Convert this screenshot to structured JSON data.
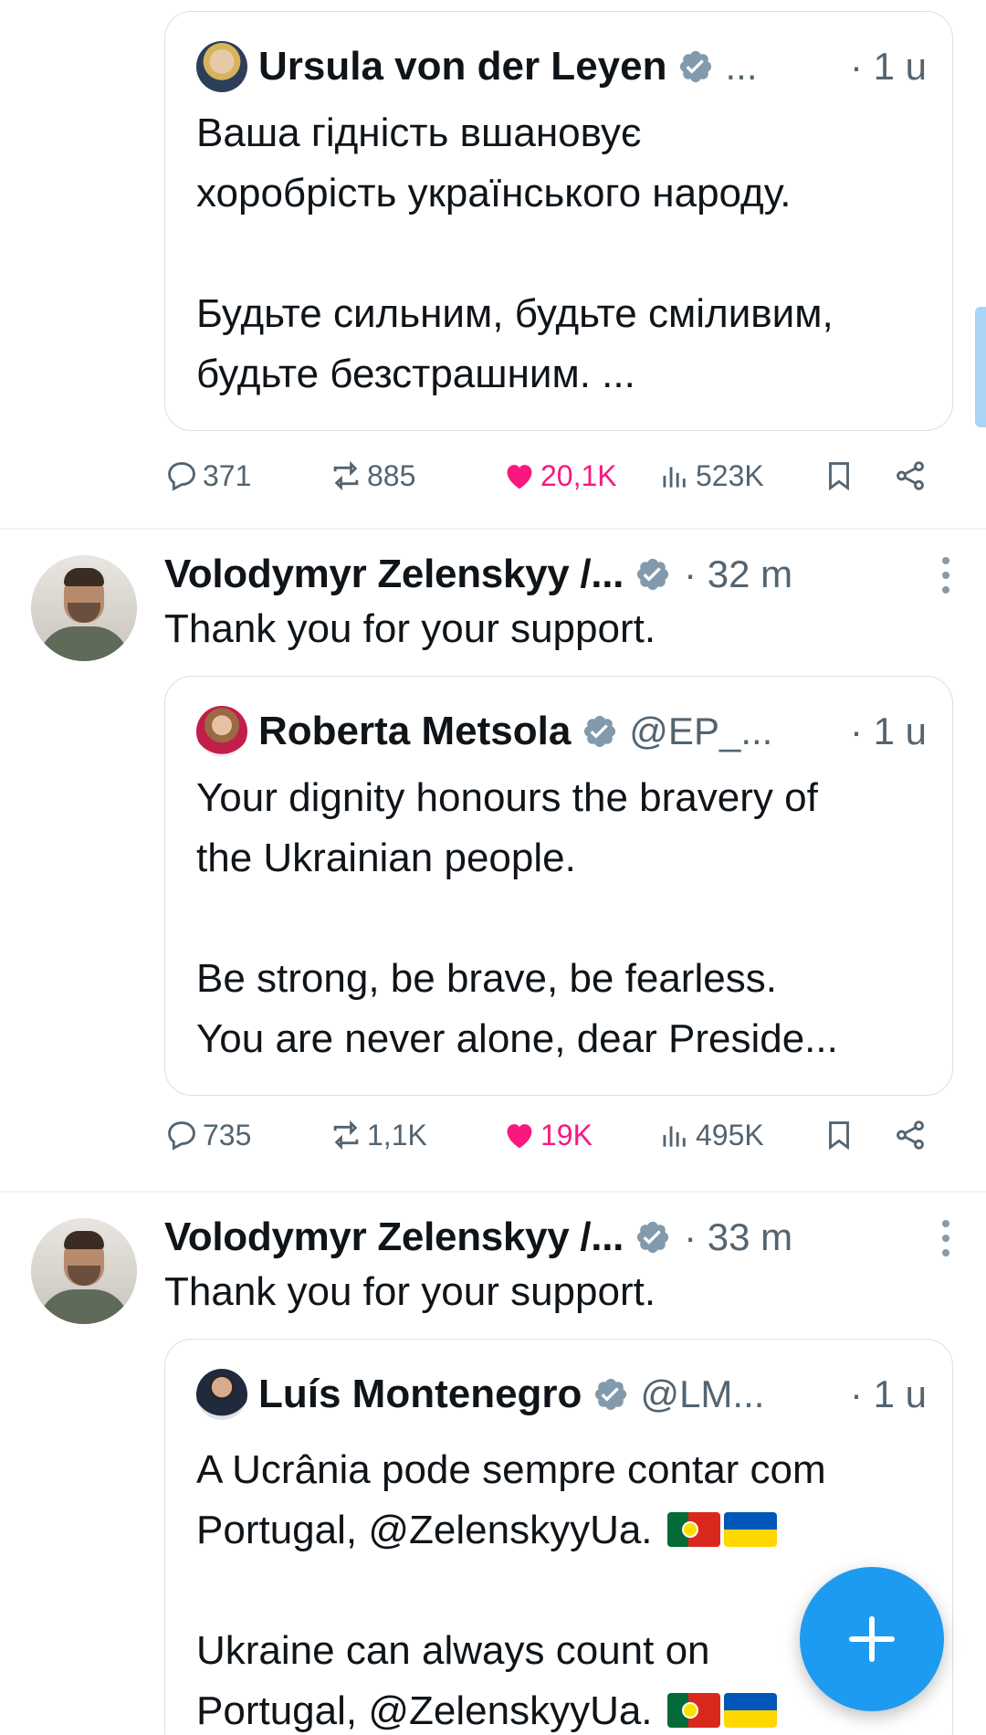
{
  "tweets": [
    {
      "quote": {
        "name": "Ursula von der Leyen",
        "handle": "...",
        "time": "· 1 u",
        "text": "Ваша гідність вшановує\nхоробрість українського народу.\n\nБудьте сильним, будьте сміливим,\nбудьте безстрашним. ..."
      },
      "actions": {
        "replies": "371",
        "reposts": "885",
        "likes": "20,1K",
        "views": "523K"
      }
    },
    {
      "name": "Volodymyr Zelenskyy /...",
      "time": "· 32 m",
      "text": "Thank you for your support.",
      "quote": {
        "name": "Roberta Metsola",
        "handle": "@EP_...",
        "time": "· 1 u",
        "text": "Your dignity honours the bravery of\nthe Ukrainian people.\n\nBe strong, be brave, be fearless.\nYou are never alone, dear Preside..."
      },
      "actions": {
        "replies": "735",
        "reposts": "1,1K",
        "likes": "19K",
        "views": "495K"
      }
    },
    {
      "name": "Volodymyr Zelenskyy /...",
      "time": "· 33 m",
      "text": "Thank you for your support.",
      "quote": {
        "name": "Luís Montenegro",
        "handle": "@LM...",
        "time": "· 1 u",
        "line1": "A Ucrânia pode sempre contar com",
        "line2": "Portugal, @ZelenskyyUa.",
        "line3": "Ukraine can always count on",
        "line4": "Portugal, @ZelenskyyUa."
      }
    }
  ],
  "icons": {
    "reply": "reply-icon",
    "repost": "repost-icon",
    "like": "heart-icon",
    "views": "views-icon",
    "bookmark": "bookmark-icon",
    "share": "share-icon",
    "verified": "verified-badge-icon",
    "more": "more-vertical-icon",
    "compose": "plus-icon"
  },
  "colors": {
    "accent": "#1d9bf0",
    "like": "#f91880",
    "secondary_text": "#536471",
    "verified_badge": "#829aab"
  }
}
